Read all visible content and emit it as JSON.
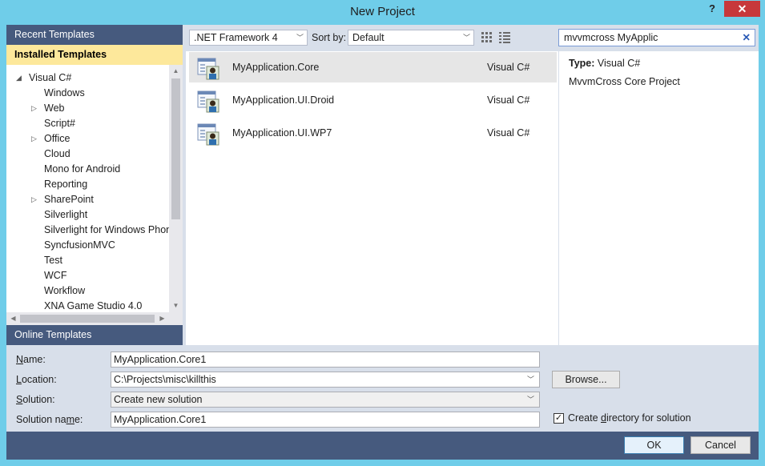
{
  "window": {
    "title": "New Project",
    "help": "?",
    "close": "✕"
  },
  "left": {
    "recent": "Recent Templates",
    "installed": "Installed Templates",
    "online": "Online Templates",
    "tree": [
      {
        "label": "Visual C#",
        "level": 0,
        "arrow": "expanded"
      },
      {
        "label": "Windows",
        "level": 1,
        "arrow": ""
      },
      {
        "label": "Web",
        "level": 1,
        "arrow": "collapsed"
      },
      {
        "label": "Script#",
        "level": 1,
        "arrow": ""
      },
      {
        "label": "Office",
        "level": 1,
        "arrow": "collapsed"
      },
      {
        "label": "Cloud",
        "level": 1,
        "arrow": ""
      },
      {
        "label": "Mono for Android",
        "level": 1,
        "arrow": ""
      },
      {
        "label": "Reporting",
        "level": 1,
        "arrow": ""
      },
      {
        "label": "SharePoint",
        "level": 1,
        "arrow": "collapsed"
      },
      {
        "label": "Silverlight",
        "level": 1,
        "arrow": ""
      },
      {
        "label": "Silverlight for Windows Phone",
        "level": 1,
        "arrow": ""
      },
      {
        "label": "SyncfusionMVC",
        "level": 1,
        "arrow": ""
      },
      {
        "label": "Test",
        "level": 1,
        "arrow": ""
      },
      {
        "label": "WCF",
        "level": 1,
        "arrow": ""
      },
      {
        "label": "Workflow",
        "level": 1,
        "arrow": ""
      },
      {
        "label": "XNA Game Studio 4.0",
        "level": 1,
        "arrow": ""
      }
    ]
  },
  "toolbar": {
    "framework": ".NET Framework 4",
    "sort_label": "Sort by:",
    "sort_value": "Default",
    "search_value": "mvvmcross MyApplic"
  },
  "templates": [
    {
      "name": "MyApplication.Core",
      "lang": "Visual C#",
      "selected": true
    },
    {
      "name": "MyApplication.UI.Droid",
      "lang": "Visual C#",
      "selected": false
    },
    {
      "name": "MyApplication.UI.WP7",
      "lang": "Visual C#",
      "selected": false
    }
  ],
  "detail": {
    "type_label": "Type:",
    "type_value": "Visual C#",
    "description": "MvvmCross Core Project"
  },
  "form": {
    "name_label": "Name:",
    "name_value": "MyApplication.Core1",
    "location_label": "Location:",
    "location_value": "C:\\Projects\\misc\\killthis",
    "browse": "Browse...",
    "solution_label": "Solution:",
    "solution_value": "Create new solution",
    "solution_name_label": "Solution name:",
    "solution_name_value": "MyApplication.Core1",
    "create_dir_label": "Create directory for solution",
    "create_dir_checked": true
  },
  "footer": {
    "ok": "OK",
    "cancel": "Cancel"
  },
  "colors": {
    "frame": "#6fcde9",
    "panel_header": "#465a7e",
    "selected_header": "#fde89b",
    "close": "#c7383b"
  }
}
